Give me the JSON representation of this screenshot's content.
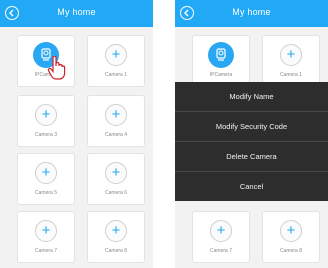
{
  "screens": [
    {
      "title": "My home",
      "cameras": [
        {
          "label": "IPCamera",
          "type": "camera"
        },
        {
          "label": "Camera 1",
          "type": "add"
        },
        {
          "label": "Camera 3",
          "type": "add"
        },
        {
          "label": "Camera 4",
          "type": "add"
        },
        {
          "label": "Camera 5",
          "type": "add"
        },
        {
          "label": "Camera 6",
          "type": "add"
        },
        {
          "label": "Camera 7",
          "type": "add"
        },
        {
          "label": "Camera 8",
          "type": "add"
        }
      ]
    },
    {
      "title": "My home",
      "cameras": [
        {
          "label": "IPCamera",
          "type": "camera"
        },
        {
          "label": "Camera 1",
          "type": "add"
        },
        {
          "label": "Camera 7",
          "type": "add"
        },
        {
          "label": "Camera 8",
          "type": "add"
        }
      ],
      "menu": {
        "items": [
          "Modify Name",
          "Modify Security Code",
          "Delete Camera",
          "Cancel"
        ]
      }
    }
  ],
  "colors": {
    "accent": "#21a9f5",
    "menu_bg": "#2d2d2d"
  },
  "icons": {
    "back": "back-arrow-icon",
    "add": "plus-icon",
    "camera": "camera-icon",
    "pointer": "hand-pointer-icon"
  }
}
